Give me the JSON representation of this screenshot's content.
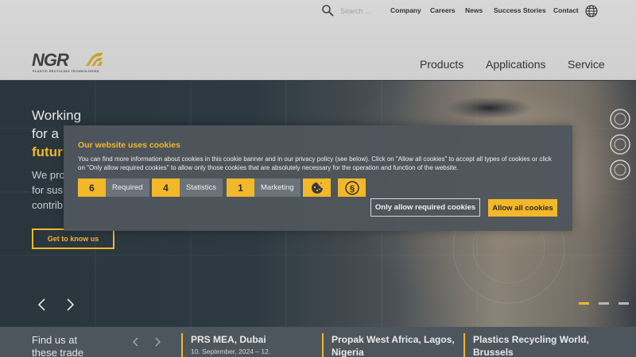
{
  "header": {
    "search": {
      "placeholder": "Search ..."
    },
    "util_links": [
      "Company",
      "Careers",
      "News",
      "Success Stories",
      "Contact"
    ],
    "logo": {
      "text": "NGR",
      "tagline": "PLASTIC RECYCLING TECHNOLOGIES"
    },
    "main_nav": [
      "Products",
      "Applications",
      "Service"
    ]
  },
  "hero": {
    "heading_line1": "Working",
    "heading_line2": "for a",
    "heading_accent": "futur",
    "sub_line1": "We pro",
    "sub_line2": "for sus",
    "sub_line3": "contrib",
    "cta_label": "Get to know us",
    "slides_active_index": 0,
    "slide_count": 3
  },
  "events": {
    "title_line1": "Find us at",
    "title_line2": "these trade",
    "items": [
      {
        "title": "PRS MEA, Dubai",
        "date": "10. September, 2024 – 12."
      },
      {
        "title": "Propak West Africa, Lagos,",
        "title2": "Nigeria"
      },
      {
        "title": "Plastics Recycling World,",
        "title2": "Brussels"
      }
    ]
  },
  "cookie_banner": {
    "title": "Our website uses cookies",
    "text": "You can find more information about cookies in this cookie banner and in our privacy policy (see below). Click on \"Allow all cookies\" to accept all types of cookies or click on \"Only allow required cookies\" to allow only those cookies that are absolutely necessary for the operation and function of the website.",
    "categories": [
      {
        "count": "6",
        "label": "Required"
      },
      {
        "count": "4",
        "label": "Statistics"
      },
      {
        "count": "1",
        "label": "Marketing"
      }
    ],
    "icon_buttons": [
      "cookie-icon",
      "paragraph-icon"
    ],
    "required_button": "Only allow required cookies",
    "allow_all_button": "Allow all cookies"
  },
  "colors": {
    "accent": "#f2b82a",
    "header_bg": "#d3d3d3",
    "modal_bg": "#4e565c"
  }
}
